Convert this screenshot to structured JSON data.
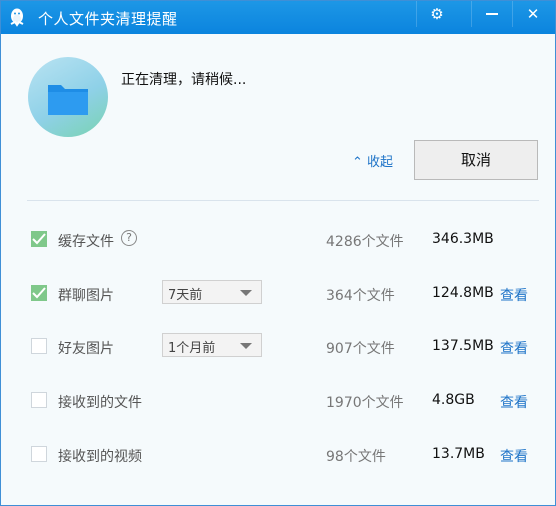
{
  "window": {
    "title": "个人文件夹清理提醒",
    "colors": {
      "titlebar": "#0b84de",
      "link": "#1f74c8",
      "checkbox_checked": "#7fc88a"
    }
  },
  "header": {
    "status": "正在清理，请稍候...",
    "collapse_label": "收起",
    "cancel_label": "取消"
  },
  "items": [
    {
      "label": "缓存文件",
      "checked": true,
      "count": "4286个文件",
      "size": "346.3MB",
      "icon": "help-icon"
    },
    {
      "label": "群聊图片",
      "checked": true,
      "dropdown": "7天前",
      "count": "364个文件",
      "size": "124.8MB",
      "action": "查看"
    },
    {
      "label": "好友图片",
      "checked": false,
      "dropdown": "1个月前",
      "count": "907个文件",
      "size": "137.5MB",
      "action": "查看"
    },
    {
      "label": "接收到的文件",
      "checked": false,
      "count": "1970个文件",
      "size": "4.8GB",
      "action": "查看"
    },
    {
      "label": "接收到的视频",
      "checked": false,
      "count": "98个文件",
      "size": "13.7MB",
      "action": "查看"
    }
  ]
}
